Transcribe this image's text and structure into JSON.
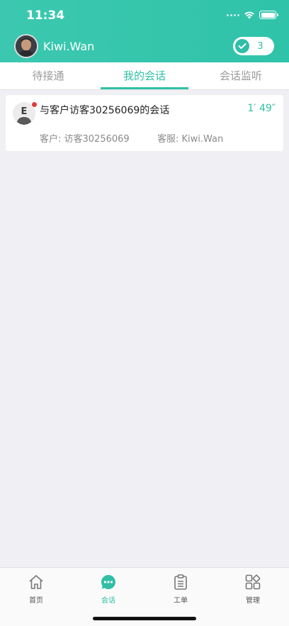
{
  "status_bar": {
    "time": "11:34"
  },
  "profile": {
    "name": "Kiwi.Wan",
    "online_count": "3"
  },
  "tabs": [
    {
      "label": "待接通",
      "active": false
    },
    {
      "label": "我的会话",
      "active": true
    },
    {
      "label": "会话监听",
      "active": false
    }
  ],
  "conversations": [
    {
      "title": "与客户访客30256069的会话",
      "duration": "1′ 49″",
      "customer": "客户: 访客30256069",
      "agent": "客服: Kiwi.Wan",
      "avatar_letter": "E",
      "unread": true
    }
  ],
  "bottom_nav": [
    {
      "label": "首页",
      "icon": "home-icon",
      "active": false
    },
    {
      "label": "会话",
      "icon": "chat-bubble-icon",
      "active": true
    },
    {
      "label": "工单",
      "icon": "clipboard-icon",
      "active": false
    },
    {
      "label": "管理",
      "icon": "grid-icon",
      "active": false
    }
  ],
  "colors": {
    "accent": "#2fbfa6",
    "header": "#35c5ac",
    "badge": "#e23b3b"
  }
}
